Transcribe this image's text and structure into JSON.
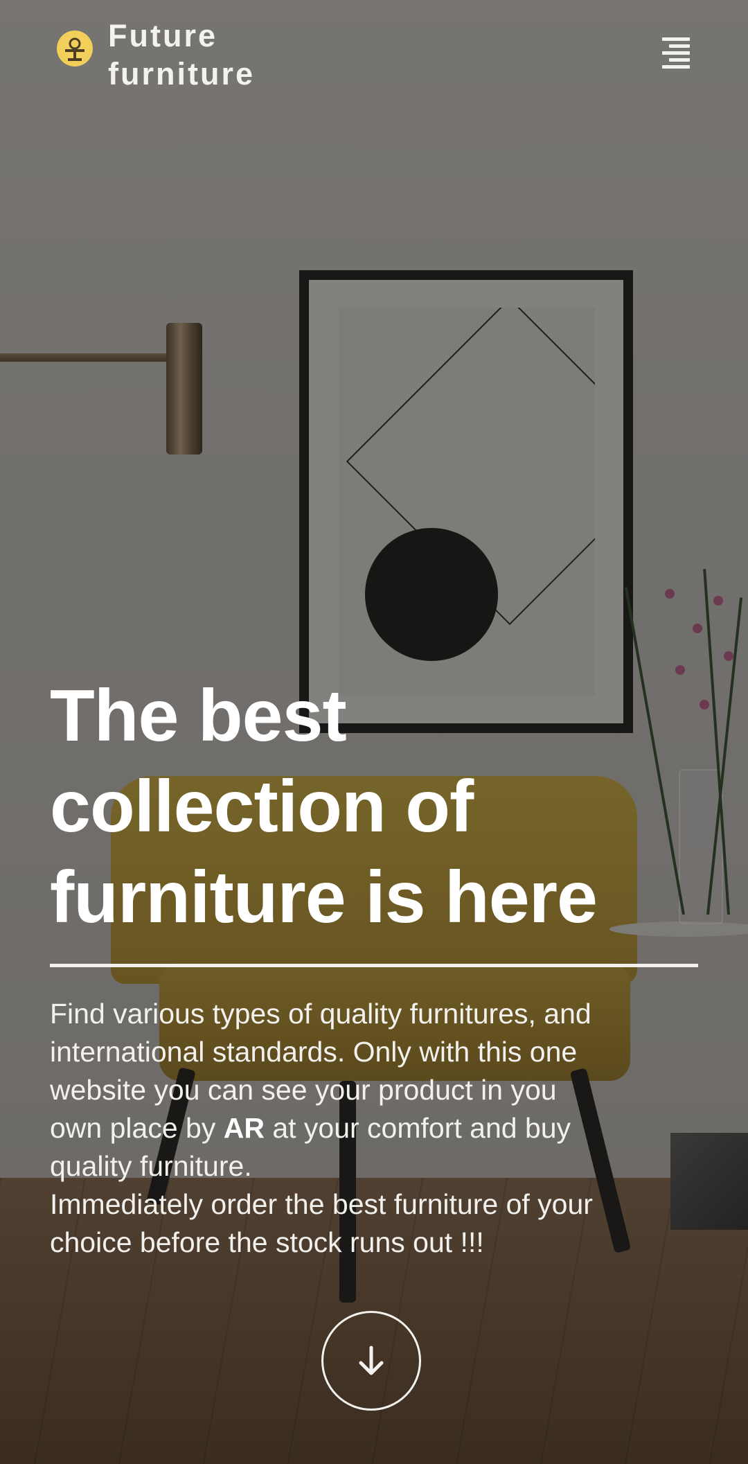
{
  "header": {
    "brand_line1": "Future",
    "brand_line2": "furniture",
    "logo_icon": "lamp-logo-icon",
    "menu_icon": "menu-icon"
  },
  "hero": {
    "title_line1": "The best",
    "title_line2": "collection of",
    "title_line3": "furniture is here",
    "desc_line1": "Find various types of quality furnitures, and",
    "desc_line2": "international standards. Only with this one",
    "desc_line3": "website you can see your product in you",
    "desc_line4_before": "own place by ",
    "desc_line4_bold": "AR",
    "desc_line4_after": " at your comfort and buy",
    "desc_line5": "quality furniture.",
    "desc_line6": "Immediately order the best furniture of your",
    "desc_line7": "choice before the stock runs out !!!",
    "scroll_icon": "arrow-down-icon"
  },
  "colors": {
    "logo_accent": "#f1cf5a",
    "text": "#ffffff",
    "overlay": "#1c1a18"
  }
}
